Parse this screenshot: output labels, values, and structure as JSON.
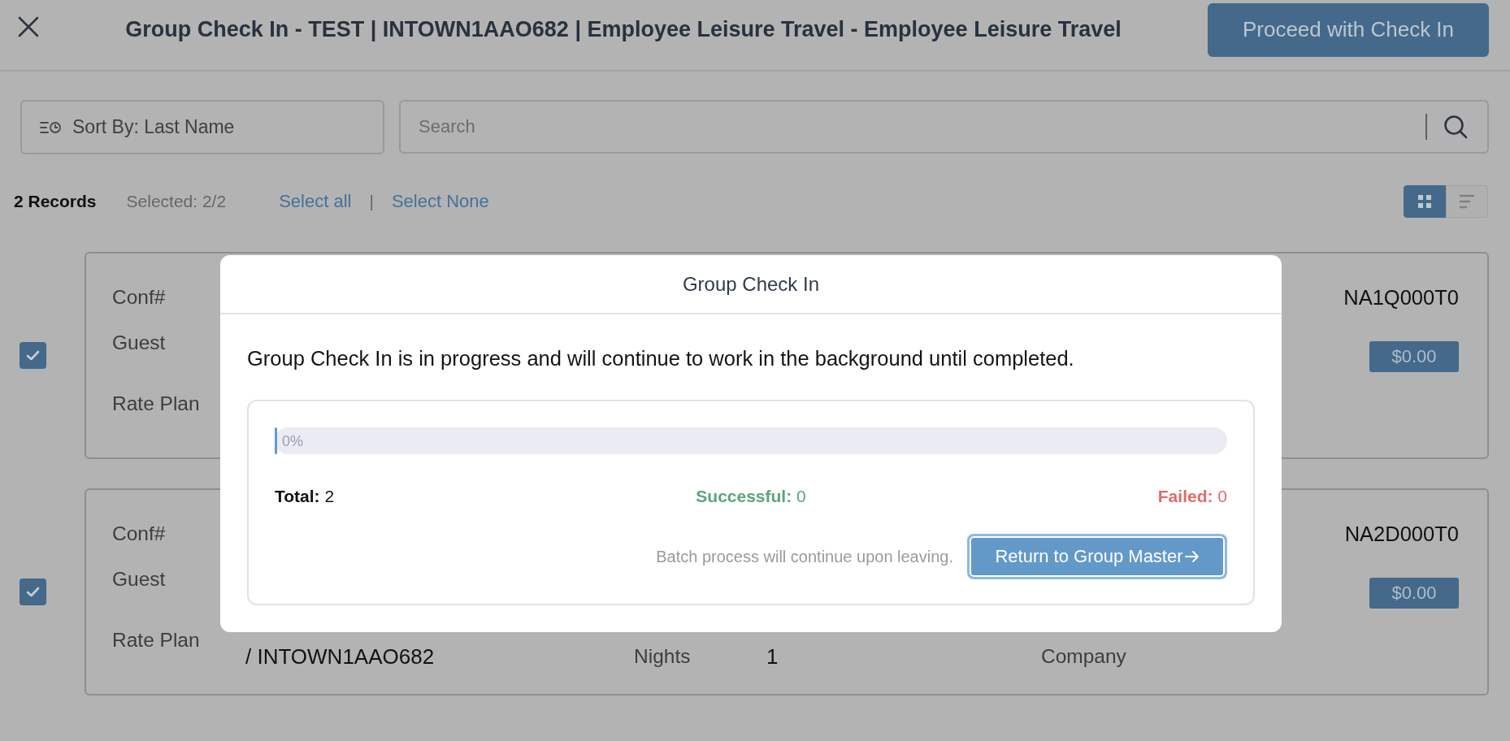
{
  "header": {
    "title": "Group Check In - TEST | INTOWN1AAO682 | Employee Leisure Travel - Employee Leisure Travel",
    "action_button": "Proceed with Check In"
  },
  "toolbar": {
    "sort": "Sort By: Last Name",
    "search": {
      "placeholder": "Search"
    }
  },
  "summary": {
    "records": "2 Records",
    "selected": "Selected: 2/2",
    "links": [
      "Select all",
      "Select None"
    ],
    "separator": "|"
  },
  "view_toggle": [
    {
      "kind": "grid",
      "selected": true
    },
    {
      "kind": "list",
      "selected": false
    }
  ],
  "cards": [
    {
      "checked": true,
      "labels": [
        "Conf#",
        "Guest",
        "Rate Plan"
      ],
      "conf_number": "NA1Q000T0",
      "balance": "$0.00"
    },
    {
      "checked": true,
      "labels": [
        "Conf#",
        "Guest",
        "Rate Plan"
      ],
      "conf_number": "NA2D000T0",
      "balance": "$0.00",
      "details": [
        {
          "kind": "value",
          "text": "/ INTOWN1AAO682"
        },
        {
          "kind": "label",
          "text": "Nights"
        },
        {
          "kind": "value",
          "text": "1"
        },
        {
          "kind": "label",
          "text": "Company"
        }
      ]
    }
  ],
  "modal": {
    "title": "Group Check In",
    "message": "Group Check In is in progress and will continue to work in the background until completed.",
    "progress": {
      "level": 0,
      "label": "0%"
    },
    "stats": [
      {
        "text": "**Total:** 2",
        "color": "#111111"
      },
      {
        "text": "**Successful:** 0",
        "color": "#5aa57a"
      },
      {
        "text": "**Failed:** 0",
        "color": "#e06b6b"
      }
    ],
    "note": "Batch process will continue upon leaving.",
    "button": "Return to Group Master"
  }
}
